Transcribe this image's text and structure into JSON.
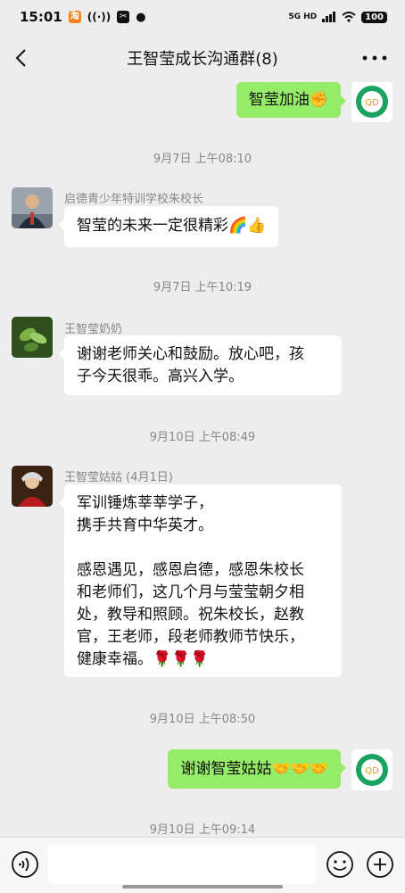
{
  "status_bar": {
    "time": "15:01",
    "network": "5G HD",
    "battery": "100"
  },
  "header": {
    "title": "王智莹成长沟通群(8)"
  },
  "messages": [
    {
      "type": "out",
      "text": "智莹加油✊"
    },
    {
      "type": "time",
      "text": "9月7日 上午08:10"
    },
    {
      "type": "in",
      "sender": "启德青少年特训学校朱校长",
      "text": "智莹的未来一定很精彩🌈👍"
    },
    {
      "type": "time",
      "text": "9月7日 上午10:19"
    },
    {
      "type": "in",
      "sender": "王智莹奶奶",
      "text": "谢谢老师关心和鼓励。放心吧，孩\n子今天很乖。高兴入学。"
    },
    {
      "type": "time",
      "text": "9月10日 上午08:49"
    },
    {
      "type": "in",
      "sender": "王智莹姑姑 (4月1日)",
      "text": "军训锤炼莘莘学子，\n携手共育中华英才。\n\n感恩遇见，感恩启德，感恩朱校长\n和老师们，这几个月与莹莹朝夕相\n处，教导和照顾。祝朱校长，赵教\n官，王老师，段老师教师节快乐，\n健康幸福。🌹🌹🌹"
    },
    {
      "type": "time",
      "text": "9月10日 上午08:50"
    },
    {
      "type": "out",
      "text": "谢谢智莹姑姑🤝🤝🤝"
    },
    {
      "type": "time",
      "text": "9月10日 上午09:14"
    }
  ],
  "my_avatar": {
    "text": "QD"
  },
  "colors": {
    "outgoing_bubble": "#95ec69",
    "accent": "#07a34f"
  }
}
